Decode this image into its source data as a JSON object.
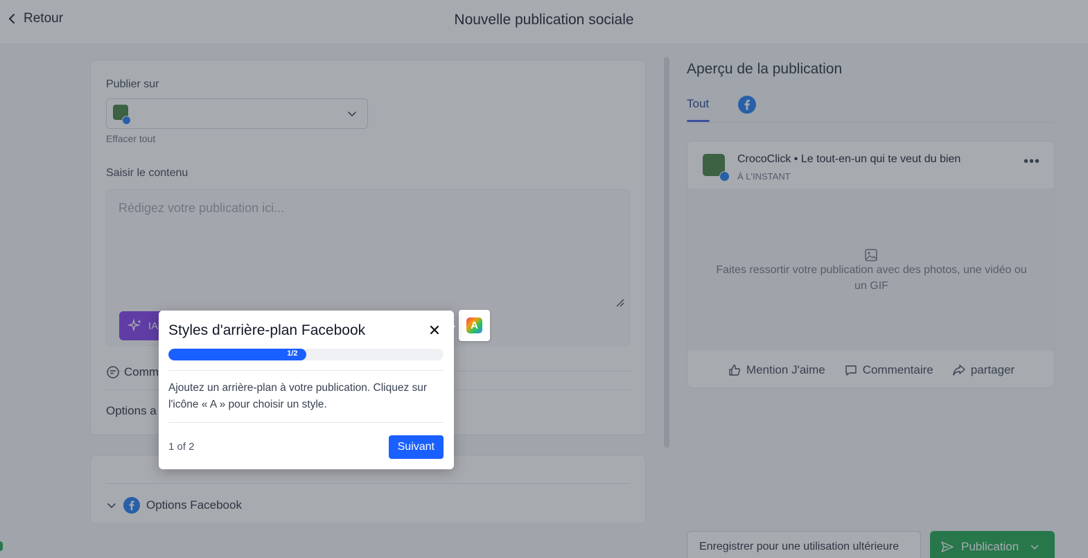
{
  "header": {
    "back_label": "Retour",
    "title": "Nouvelle publication sociale"
  },
  "compose": {
    "publish_on_label": "Publier sur",
    "clear_all": "Effacer tout",
    "content_label": "Saisir le contenu",
    "content_placeholder": "Rédigez votre publication ici...",
    "ai_button_label": "IA",
    "comments_label": "Comm",
    "options_label": "Options a",
    "facebook_options_label": "Options Facebook"
  },
  "preview": {
    "title": "Aperçu de la publication",
    "tab_all": "Tout",
    "page_name": "CrocoClick • Le tout-en-un qui te veut du bien",
    "time": "À L'INSTANT",
    "media_text": "Faites ressortir votre publication avec des photos, une vidéo ou un GIF",
    "action_like": "Mention J'aime",
    "action_comment": "Commentaire",
    "action_share": "partager"
  },
  "footer": {
    "save_label": "Enregistrer pour une utilisation ultérieure",
    "publish_label": "Publication"
  },
  "tour": {
    "title": "Styles d'arrière-plan Facebook",
    "progress_label": "1/2",
    "progress_fraction": 0.5,
    "body": "Ajoutez un arrière-plan à votre publication. Cliquez sur l'icône « A » pour choisir un style.",
    "step_count": "1 of 2",
    "next_label": "Suivant",
    "style_icon_letter": "A"
  },
  "colors": {
    "facebook": "#1877f2",
    "publish_green": "#16a34a",
    "ai_purple": "#7c3aed",
    "tour_blue": "#1a5fff"
  }
}
